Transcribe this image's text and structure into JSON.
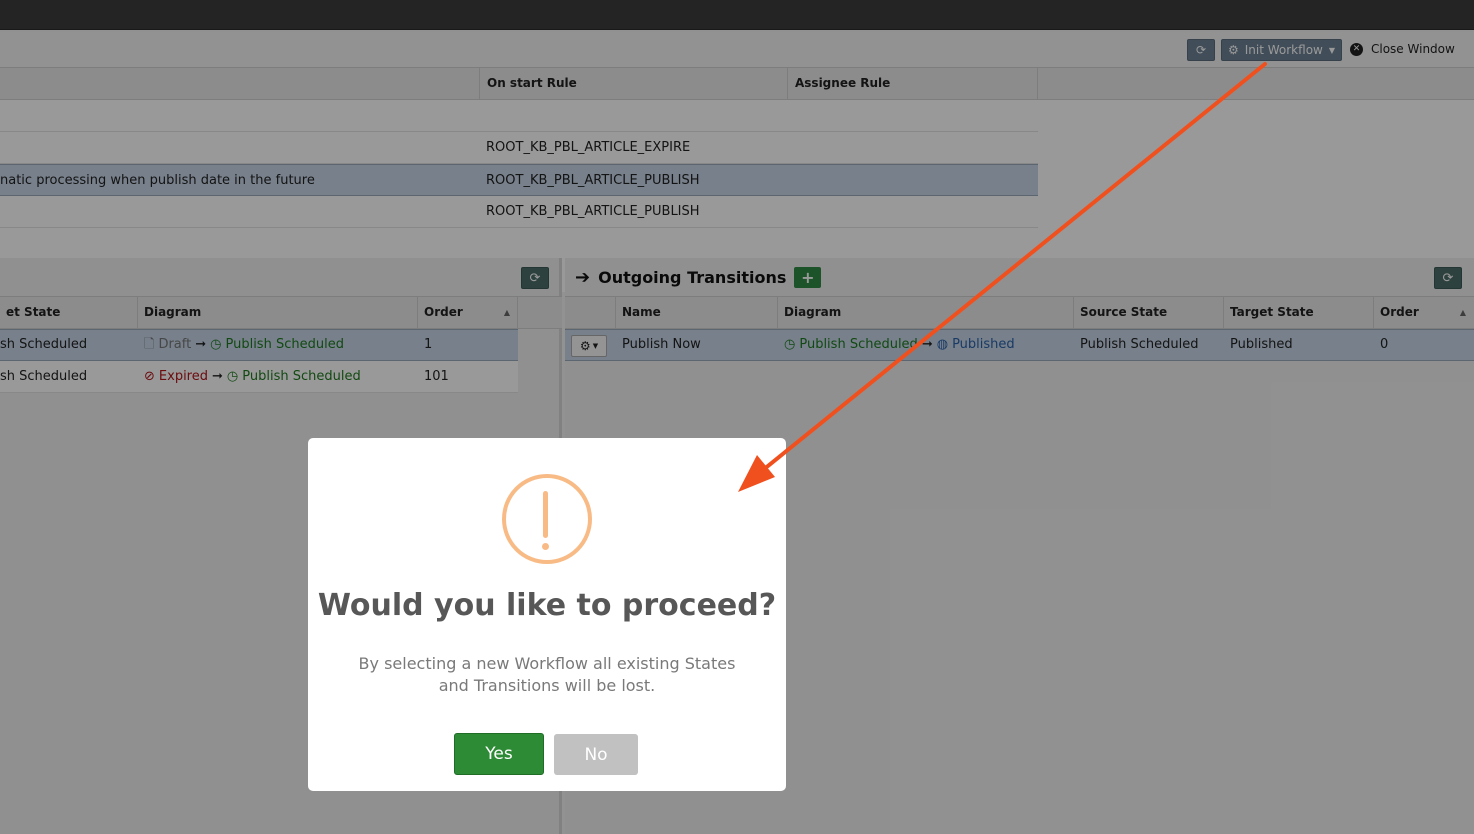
{
  "toolbar": {
    "init_label": "Init Workflow",
    "close_label": "Close Window"
  },
  "top_grid": {
    "headers": [
      "On start Rule",
      "Assignee Rule"
    ],
    "rows": [
      {
        "desc": "",
        "rule": ""
      },
      {
        "desc": "",
        "rule": "ROOT_KB_PBL_ARTICLE_EXPIRE"
      },
      {
        "desc": "natic processing when publish date in the future",
        "rule": "ROOT_KB_PBL_ARTICLE_PUBLISH"
      },
      {
        "desc": "",
        "rule": "ROOT_KB_PBL_ARTICLE_PUBLISH"
      }
    ]
  },
  "incoming": {
    "headers": [
      "et State",
      "Diagram",
      "Order"
    ],
    "rows": [
      {
        "target": "sh Scheduled",
        "from": "Draft",
        "to": "Publish Scheduled",
        "order": "1"
      },
      {
        "target": "sh Scheduled",
        "from": "Expired",
        "to": "Publish Scheduled",
        "order": "101"
      }
    ]
  },
  "outgoing": {
    "title": "Outgoing Transitions",
    "headers": [
      "Name",
      "Diagram",
      "Source State",
      "Target State",
      "Order"
    ],
    "rows": [
      {
        "name": "Publish Now",
        "from": "Publish Scheduled",
        "to": "Published",
        "source": "Publish Scheduled",
        "target": "Published",
        "order": "0"
      }
    ]
  },
  "dialog": {
    "title": "Would you like to proceed?",
    "text": "By selecting a new Workflow all existing States and Transitions will be lost.",
    "yes": "Yes",
    "no": "No"
  },
  "colors": {
    "accent_green": "#2e8b35",
    "warning": "#f8bb86",
    "annotation_arrow": "#f0501e"
  }
}
